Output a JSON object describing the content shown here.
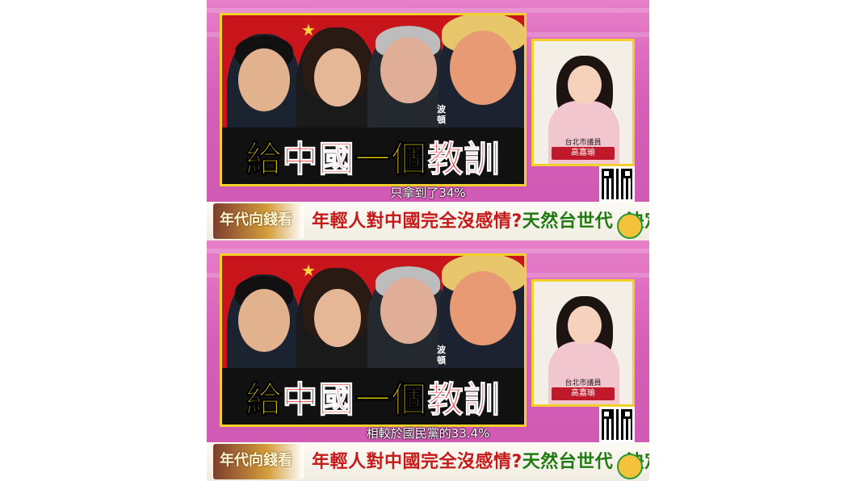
{
  "headline": {
    "part1": "給",
    "part2": "中國",
    "part3": "一個",
    "part4": "教訓"
  },
  "name_tag": "波頓",
  "guest": {
    "title": "台北市議員",
    "name": "高嘉瑜"
  },
  "frames": [
    {
      "subtitle": "只拿到了34%"
    },
    {
      "subtitle": "相較於國民黨的33.4%"
    }
  ],
  "ticker": {
    "logo": "年代向錢看",
    "line1": "年輕人對中國完全沒感情?",
    "line2": "天然台世代",
    "line3": "決定台灣未來?"
  },
  "colors": {
    "background": "#d560b8",
    "panel_red": "#c8141b",
    "frame_yellow": "#f2d02b",
    "headline_yellow": "#ffe600",
    "headline_red": "#e3242b"
  }
}
